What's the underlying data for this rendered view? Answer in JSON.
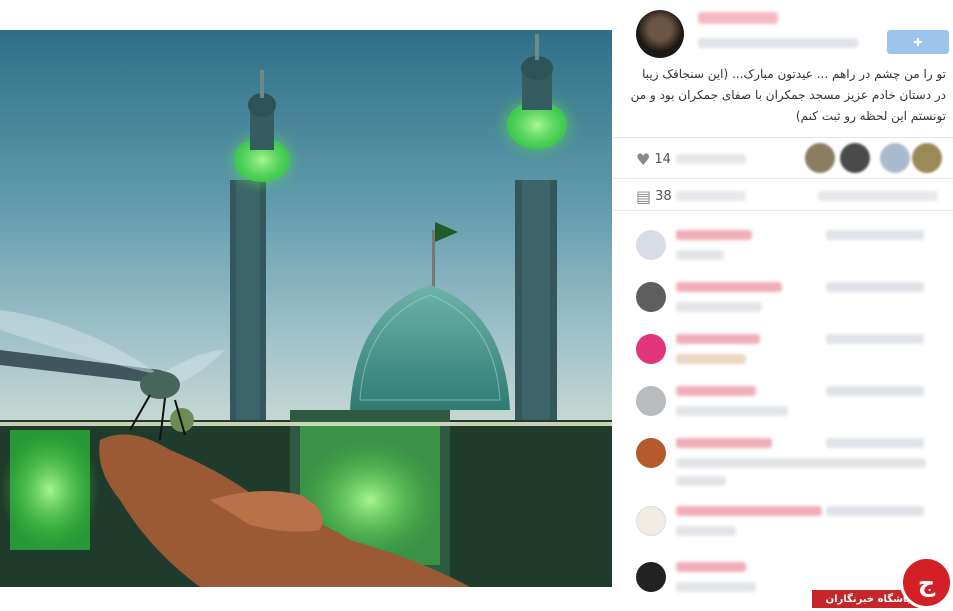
{
  "post": {
    "caption": "تو را من چشم در راهم ... عیدتون مبارک... (این سنجاقک زیبا در دستان خادم عزیز مسجد جمکران با صفای جمکران بود و من تونستم این لحظه رو ثبت کنم)",
    "follow_label": "",
    "likes_label": "14",
    "comments_count_label": "38"
  },
  "icons": {
    "like": "heart-icon",
    "comment": "comment-icon",
    "follow": "follow-icon"
  },
  "watermark": {
    "text": "باشگاه خبرنگاران",
    "logo_glyph": "ج"
  },
  "colors": {
    "username_pink": "#f0aeba",
    "follow_blue": "#9cc4ec",
    "watermark_red": "#d32027"
  }
}
